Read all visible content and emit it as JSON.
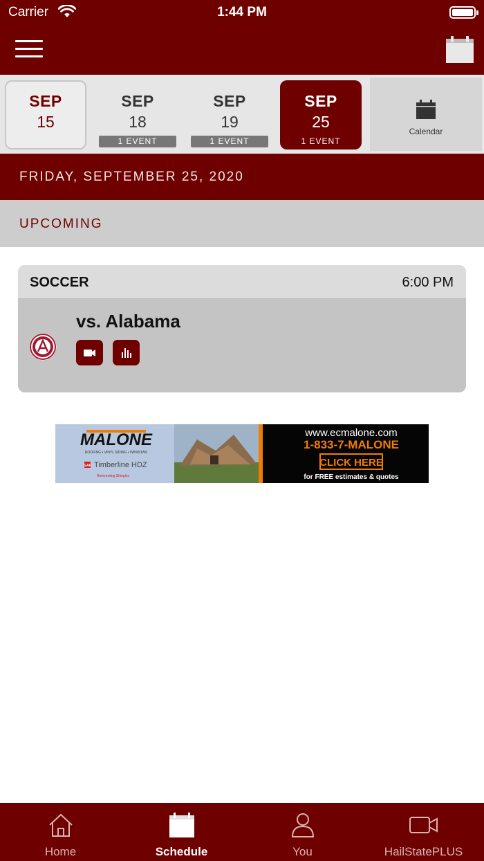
{
  "status_bar": {
    "carrier": "Carrier",
    "time": "1:44 PM"
  },
  "date_strip": {
    "days": [
      {
        "month": "SEP",
        "day": "15",
        "badge": ""
      },
      {
        "month": "SEP",
        "day": "18",
        "badge": "1 EVENT"
      },
      {
        "month": "SEP",
        "day": "19",
        "badge": "1 EVENT"
      },
      {
        "month": "SEP",
        "day": "25",
        "badge": "1 EVENT"
      }
    ],
    "calendar_label": "Calendar"
  },
  "date_header": "FRIDAY, SEPTEMBER 25, 2020",
  "section_label": "UPCOMING",
  "event": {
    "sport": "SOCCER",
    "time": "6:00 PM",
    "opponent": "vs. Alabama"
  },
  "ad": {
    "brand": "MALONE",
    "tagline": "ROOFING • VINYL SIDING • WINDOWS",
    "partner": "Timberline HDZ",
    "partner_prefix": "GAF",
    "partner_sub": "Reinventing Shingles",
    "url": "www.ecmalone.com",
    "phone": "1-833-7-MALONE",
    "cta": "CLICK HERE",
    "note": "for FREE estimates & quotes"
  },
  "tabs": [
    {
      "label": "Home",
      "icon": "home-icon"
    },
    {
      "label": "Schedule",
      "icon": "calendar-icon"
    },
    {
      "label": "You",
      "icon": "person-icon"
    },
    {
      "label": "HailStatePLUS",
      "icon": "video-camera-icon"
    }
  ],
  "colors": {
    "brand": "#6f0000",
    "strip": "#e6e6e6",
    "section": "#cdcdcd",
    "card": "#c4c4c4"
  }
}
